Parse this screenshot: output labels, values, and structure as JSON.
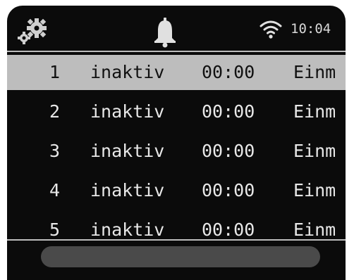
{
  "status_bar": {
    "settings_icon": "gears-icon",
    "alarm_icon": "bell-icon",
    "wifi_icon": "wifi-icon",
    "time": "10:04"
  },
  "alarms": [
    {
      "number": "1",
      "state": "inaktiv",
      "time": "00:00",
      "repeat": "Einm",
      "selected": true
    },
    {
      "number": "2",
      "state": "inaktiv",
      "time": "00:00",
      "repeat": "Einm",
      "selected": false
    },
    {
      "number": "3",
      "state": "inaktiv",
      "time": "00:00",
      "repeat": "Einm",
      "selected": false
    },
    {
      "number": "4",
      "state": "inaktiv",
      "time": "00:00",
      "repeat": "Einm",
      "selected": false
    },
    {
      "number": "5",
      "state": "inaktiv",
      "time": "00:00",
      "repeat": "Einm",
      "selected": false
    }
  ],
  "colors": {
    "screen_background": "#0b0b0b",
    "text": "#e8e8e8",
    "selection": "#bdbdbd",
    "bottom_bar": "#4a4a4a"
  }
}
